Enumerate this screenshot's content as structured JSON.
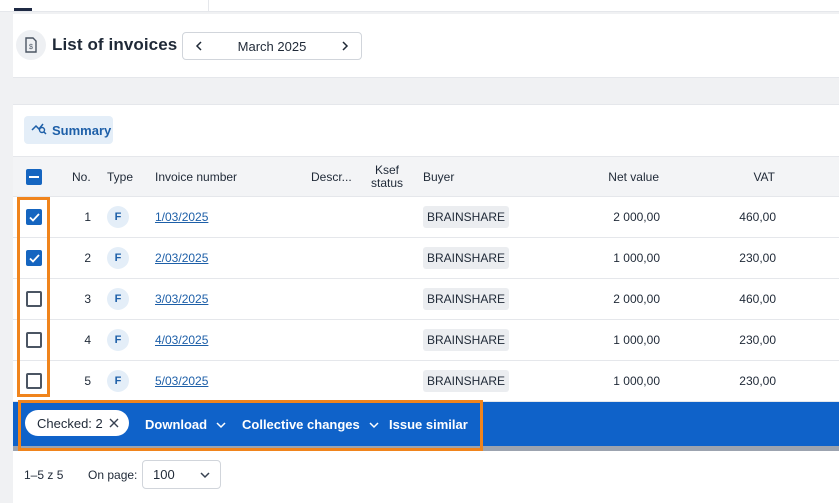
{
  "header": {
    "title": "List of invoices",
    "month": "March 2025",
    "doc_icon": "document-dollar-icon",
    "prev_icon": "chevron-left-icon",
    "next_icon": "chevron-right-icon"
  },
  "toolbar": {
    "summary_label": "Summary",
    "summary_icon": "chart-search-icon"
  },
  "table": {
    "columns": {
      "no": "No.",
      "type": "Type",
      "invoice_number": "Invoice number",
      "description": "Descr...",
      "ksef_line1": "Ksef",
      "ksef_line2": "status",
      "buyer": "Buyer",
      "net_value": "Net value",
      "vat": "VAT"
    },
    "rows": [
      {
        "checked": true,
        "no": "1",
        "type": "F",
        "invoice": "1/03/2025",
        "buyer": "BRAINSHARE",
        "net": "2 000,00",
        "vat": "460,00"
      },
      {
        "checked": true,
        "no": "2",
        "type": "F",
        "invoice": "2/03/2025",
        "buyer": "BRAINSHARE",
        "net": "1 000,00",
        "vat": "230,00"
      },
      {
        "checked": false,
        "no": "3",
        "type": "F",
        "invoice": "3/03/2025",
        "buyer": "BRAINSHARE",
        "net": "2 000,00",
        "vat": "460,00"
      },
      {
        "checked": false,
        "no": "4",
        "type": "F",
        "invoice": "4/03/2025",
        "buyer": "BRAINSHARE",
        "net": "1 000,00",
        "vat": "230,00"
      },
      {
        "checked": false,
        "no": "5",
        "type": "F",
        "invoice": "5/03/2025",
        "buyer": "BRAINSHARE",
        "net": "1 000,00",
        "vat": "230,00"
      }
    ]
  },
  "action_bar": {
    "checked_label": "Checked: 2",
    "download_label": "Download",
    "collective_label": "Collective changes",
    "issue_similar_label": "Issue similar"
  },
  "pagination": {
    "range": "1–5 z 5",
    "on_page_label": "On page:",
    "page_size": "100"
  },
  "colors": {
    "primary": "#1565c0",
    "action_bar": "#0f62c9",
    "link": "#1d5fa8",
    "highlight": "#f0841c"
  }
}
